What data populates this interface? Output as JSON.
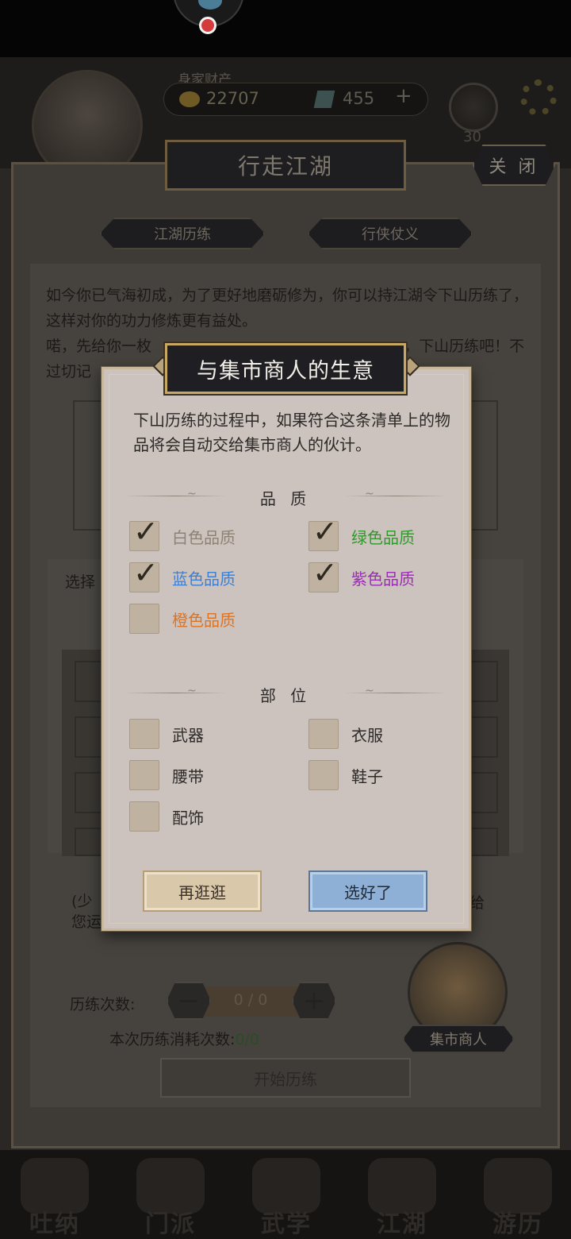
{
  "bg": {
    "wealth_label": "身家财产",
    "coins": "22707",
    "gems": "455",
    "plus": "+",
    "level": "30",
    "panel_title": "行走江湖",
    "close": "关 闭",
    "tabs": [
      "江湖历练",
      "行侠仗义"
    ],
    "intro_line1": "如今你已气海初成，为了更好地磨砺修为，你可以持江湖令下山历练了，这样对你的功力修炼更有益处。",
    "intro_line2": "喏，先给你一枚",
    "intro_line2b": "，下山历练吧！不",
    "intro_line3": "过切记",
    "choose_label": "选择",
    "note_left": "(少",
    "note_left2": "您运",
    "note_right": "给",
    "count_label": "历练次数:",
    "count_value": "0 / 0",
    "minus": "−",
    "plus_btn": "+",
    "consume_label": "本次历练消耗次数:",
    "consume_value": "0/0",
    "start": "开始历练",
    "merchant": "集市商人",
    "nav": [
      "吐纳",
      "门派",
      "武学",
      "江湖",
      "游历"
    ]
  },
  "dialog": {
    "title": "与集市商人的生意",
    "desc": "下山历练的过程中，如果符合这条清单上的物品将会自动交给集市商人的伙计。",
    "quality_title": "品 质",
    "slot_title": "部 位",
    "quality": [
      {
        "label": "白色品质",
        "checked": true,
        "color": "#8e8274"
      },
      {
        "label": "绿色品质",
        "checked": true,
        "color": "#2f9a2a"
      },
      {
        "label": "蓝色品质",
        "checked": true,
        "color": "#3b7fd6"
      },
      {
        "label": "紫色品质",
        "checked": true,
        "color": "#9b2cb4"
      },
      {
        "label": "橙色品质",
        "checked": false,
        "color": "#e0731f"
      }
    ],
    "slots": [
      {
        "label": "武器",
        "checked": false
      },
      {
        "label": "衣服",
        "checked": false
      },
      {
        "label": "腰带",
        "checked": false
      },
      {
        "label": "鞋子",
        "checked": false
      },
      {
        "label": "配饰",
        "checked": false
      }
    ],
    "btn_cancel": "再逛逛",
    "btn_ok": "选好了",
    "check_glyph": "✓"
  }
}
